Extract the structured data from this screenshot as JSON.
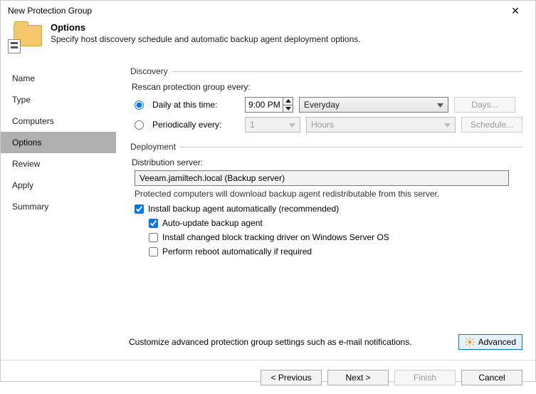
{
  "window": {
    "title": "New Protection Group",
    "close_glyph": "✕"
  },
  "header": {
    "title": "Options",
    "subtitle": "Specify host discovery schedule and automatic backup agent deployment options."
  },
  "sidebar": {
    "items": [
      {
        "label": "Name"
      },
      {
        "label": "Type"
      },
      {
        "label": "Computers"
      },
      {
        "label": "Options"
      },
      {
        "label": "Review"
      },
      {
        "label": "Apply"
      },
      {
        "label": "Summary"
      }
    ],
    "selected_index": 3
  },
  "discovery": {
    "legend": "Discovery",
    "rescan_label": "Rescan protection group every:",
    "daily_label": "Daily at this time:",
    "daily_time": "9:00 PM",
    "daily_day": "Everyday",
    "days_btn": "Days...",
    "periodic_label": "Periodically every:",
    "periodic_value": "1",
    "periodic_unit": "Hours",
    "schedule_btn": "Schedule..."
  },
  "deployment": {
    "legend": "Deployment",
    "dist_label": "Distribution server:",
    "dist_value": "Veeam.jamiltech.local (Backup server)",
    "info": "Protected computers will download backup agent redistributable from this server.",
    "install_label": "Install backup agent automatically (recommended)",
    "autoupdate_label": "Auto-update backup agent",
    "cbt_label": "Install changed block tracking driver on Windows Server OS",
    "reboot_label": "Perform reboot automatically if required"
  },
  "advanced": {
    "text": "Customize advanced protection group settings such as e-mail notifications.",
    "button": "Advanced"
  },
  "footer": {
    "prev": "< Previous",
    "next": "Next >",
    "finish": "Finish",
    "cancel": "Cancel"
  }
}
